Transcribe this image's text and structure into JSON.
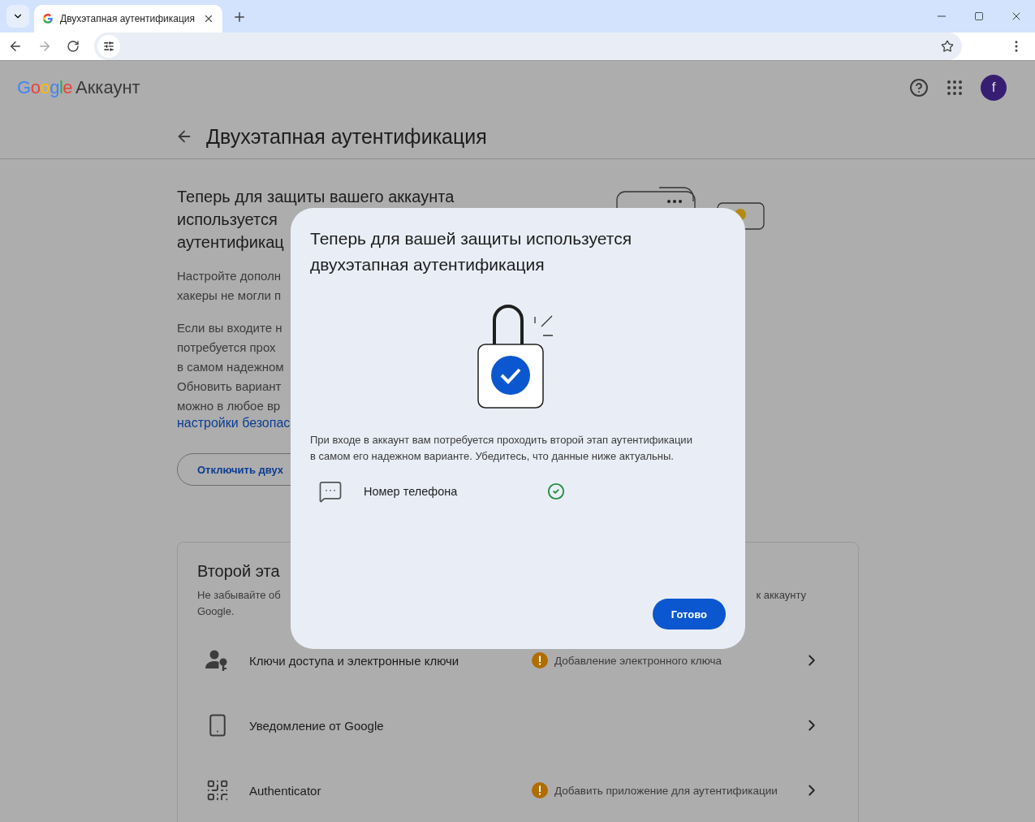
{
  "browser": {
    "tabs": [
      {
        "title": "Двухэтапная аутентификация",
        "selected": true
      }
    ]
  },
  "header": {
    "logo": {
      "brand": "Google",
      "product": "Аккаунт"
    },
    "avatar": "f"
  },
  "page_title": "Двухэтапная аутентификация",
  "intro": {
    "heading_lines": [
      "Теперь для защиты вашего аккаунта",
      "используется",
      "аутентификац"
    ],
    "paragraphs": [
      [
        "Настройте дополн",
        "хакеры не могли п"
      ],
      [
        "Если вы входите н",
        "потребуется прох",
        "в самом надежном",
        "Обновить вариант",
        "можно в любое вр"
      ]
    ],
    "link": "настройки безопас",
    "button": "Отключить двух"
  },
  "second_step": {
    "title": "Второй эта",
    "description_left": "Не забывайте об",
    "description_right": "к аккаунту",
    "description_end": "Google.",
    "methods": [
      {
        "kind": "passkey",
        "label": "Ключи доступа и электронные ключи",
        "status": "Добавление электронного ключа",
        "warning": true
      },
      {
        "kind": "phone",
        "label": "Уведомление от Google",
        "warning": false
      },
      {
        "kind": "authenticator",
        "label": "Authenticator",
        "status": "Добавить приложение для аутентификации",
        "warning": true
      }
    ]
  },
  "dialog": {
    "title": "Теперь для вашей защиты используется двухэтапная аутентификация",
    "body": "При входе в аккаунт вам потребуется проходить второй этап аутентификации в самом его надежном варианте. Убедитесь, что данные ниже актуальны.",
    "methods": [
      {
        "kind": "sms",
        "label": "Номер телефона",
        "verified": true
      }
    ],
    "button": "Готово"
  }
}
